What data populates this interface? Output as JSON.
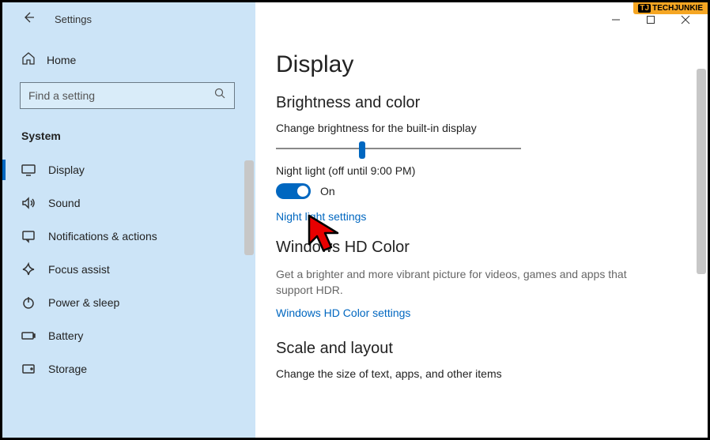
{
  "watermark": "TECHJUNKIE",
  "titlebar": {
    "title": "Settings"
  },
  "sidebar": {
    "home": "Home",
    "search_placeholder": "Find a setting",
    "category": "System",
    "items": [
      {
        "label": "Display",
        "active": true
      },
      {
        "label": "Sound"
      },
      {
        "label": "Notifications & actions"
      },
      {
        "label": "Focus assist"
      },
      {
        "label": "Power & sleep"
      },
      {
        "label": "Battery"
      },
      {
        "label": "Storage"
      }
    ]
  },
  "content": {
    "page_title": "Display",
    "section_brightness": "Brightness and color",
    "brightness_label": "Change brightness for the built-in display",
    "brightness_percent": 35,
    "night_light_label": "Night light (off until 9:00 PM)",
    "night_light_state": "On",
    "night_light_link": "Night light settings",
    "hd_color_title": "Windows HD Color",
    "hd_color_desc": "Get a brighter and more vibrant picture for videos, games and apps that support HDR.",
    "hd_color_link": "Windows HD Color settings",
    "scale_title": "Scale and layout",
    "scale_label": "Change the size of text, apps, and other items"
  }
}
